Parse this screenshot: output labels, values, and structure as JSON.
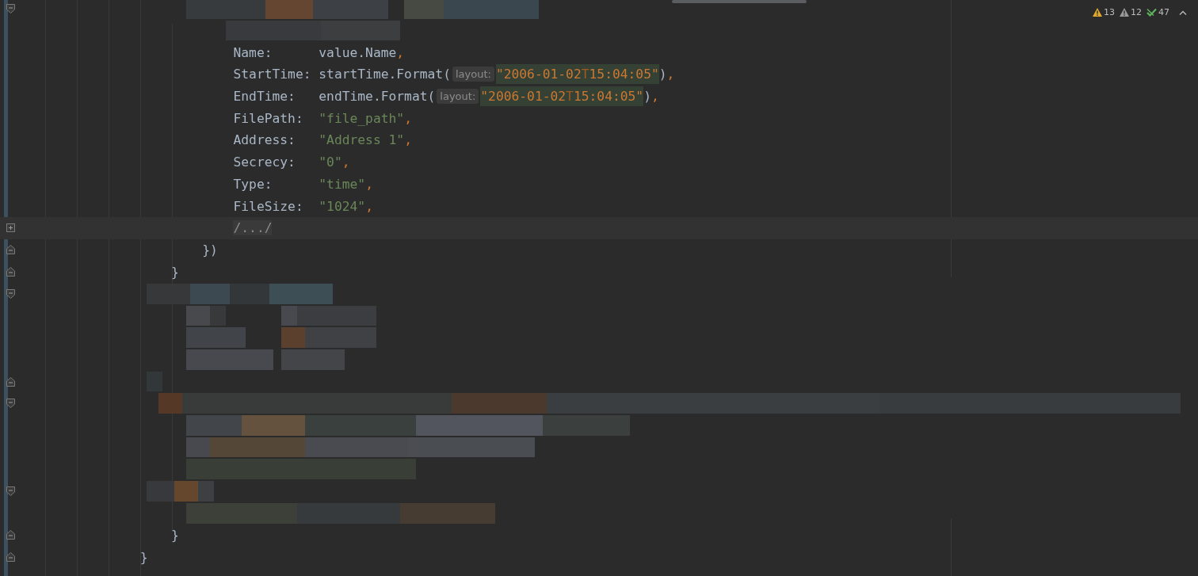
{
  "inspections": [
    {
      "kind": "warning",
      "count": "13"
    },
    {
      "kind": "weak",
      "count": "12"
    },
    {
      "kind": "ok",
      "count": "47"
    }
  ],
  "rows": [
    {
      "kind": "redacted",
      "marker": {
        "kind": "start"
      },
      "current": false
    },
    {
      "kind": "redacted",
      "current": false
    },
    {
      "kind": "code",
      "current": false,
      "tokens": [
        {
          "kind": "plain",
          "text": "                            Name:      value.Name"
        },
        {
          "kind": "punct",
          "text": ","
        }
      ]
    },
    {
      "kind": "code",
      "current": false,
      "tokens": [
        {
          "kind": "plain",
          "text": "                            StartTime: startTime.Format("
        },
        {
          "kind": "hint",
          "text": "layout:"
        },
        {
          "kind": "date",
          "text": "\"2006-01-02"
        },
        {
          "kind": "date-mark",
          "text": "T"
        },
        {
          "kind": "date",
          "text": "15:04:05\""
        },
        {
          "kind": "plain",
          "text": ")"
        },
        {
          "kind": "punct",
          "text": ","
        }
      ]
    },
    {
      "kind": "code",
      "current": false,
      "tokens": [
        {
          "kind": "plain",
          "text": "                            EndTime:   endTime.Format("
        },
        {
          "kind": "hint",
          "text": "layout:"
        },
        {
          "kind": "date",
          "text": "\"2006-01-02"
        },
        {
          "kind": "date-mark",
          "text": "T"
        },
        {
          "kind": "date",
          "text": "15:04:05\""
        },
        {
          "kind": "plain",
          "text": ")"
        },
        {
          "kind": "punct",
          "text": ","
        }
      ]
    },
    {
      "kind": "code",
      "current": false,
      "tokens": [
        {
          "kind": "plain",
          "text": "                            FilePath:  "
        },
        {
          "kind": "string",
          "text": "\"file_path\""
        },
        {
          "kind": "punct",
          "text": ","
        }
      ]
    },
    {
      "kind": "code",
      "current": false,
      "tokens": [
        {
          "kind": "plain",
          "text": "                            Address:   "
        },
        {
          "kind": "string",
          "text": "\"Address 1\""
        },
        {
          "kind": "punct",
          "text": ","
        }
      ]
    },
    {
      "kind": "code",
      "current": false,
      "tokens": [
        {
          "kind": "plain",
          "text": "                            Secrecy:   "
        },
        {
          "kind": "string",
          "text": "\"0\""
        },
        {
          "kind": "punct",
          "text": ","
        }
      ]
    },
    {
      "kind": "code",
      "current": false,
      "tokens": [
        {
          "kind": "plain",
          "text": "                            Type:      "
        },
        {
          "kind": "string",
          "text": "\"time\""
        },
        {
          "kind": "punct",
          "text": ","
        }
      ]
    },
    {
      "kind": "code",
      "current": false,
      "tokens": [
        {
          "kind": "plain",
          "text": "                            FileSize:  "
        },
        {
          "kind": "string",
          "text": "\"1024\""
        },
        {
          "kind": "punct",
          "text": ","
        }
      ]
    },
    {
      "kind": "code",
      "marker": {
        "kind": "collapsed"
      },
      "current": true,
      "tokens": [
        {
          "kind": "folded",
          "text": "                            /.../"
        }
      ]
    },
    {
      "kind": "code",
      "marker": {
        "kind": "end"
      },
      "current": false,
      "tokens": [
        {
          "kind": "plain",
          "text": "                        })"
        }
      ]
    },
    {
      "kind": "code",
      "marker": {
        "kind": "end"
      },
      "current": false,
      "tokens": [
        {
          "kind": "plain",
          "text": "                    }"
        }
      ]
    },
    {
      "kind": "redacted",
      "marker": {
        "kind": "start"
      },
      "current": false
    },
    {
      "kind": "redacted",
      "current": false
    },
    {
      "kind": "redacted",
      "current": false
    },
    {
      "kind": "redacted",
      "current": false
    },
    {
      "kind": "redacted",
      "marker": {
        "kind": "end"
      },
      "current": false
    },
    {
      "kind": "redacted",
      "marker": {
        "kind": "start"
      },
      "current": false
    },
    {
      "kind": "redacted",
      "current": false
    },
    {
      "kind": "redacted",
      "current": false
    },
    {
      "kind": "redacted",
      "current": false
    },
    {
      "kind": "redacted",
      "marker": {
        "kind": "start"
      },
      "current": false
    },
    {
      "kind": "redacted",
      "current": false
    },
    {
      "kind": "code",
      "marker": {
        "kind": "end"
      },
      "current": false,
      "tokens": [
        {
          "kind": "plain",
          "text": "                    }"
        }
      ]
    },
    {
      "kind": "code",
      "marker": {
        "kind": "end"
      },
      "current": false,
      "tokens": [
        {
          "kind": "plain",
          "text": "                }"
        }
      ]
    }
  ]
}
